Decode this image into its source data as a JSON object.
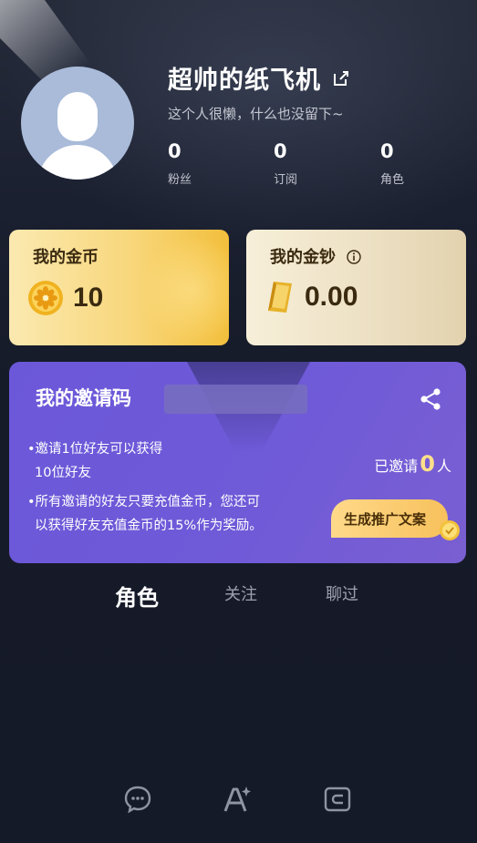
{
  "profile": {
    "name": "超帅的纸飞机",
    "bio": "这个人很懒，什么也没留下~",
    "stats": [
      {
        "value": "0",
        "label": "粉丝"
      },
      {
        "value": "0",
        "label": "订阅"
      },
      {
        "value": "0",
        "label": "角色"
      }
    ]
  },
  "wallet": {
    "coins": {
      "title": "我的金币",
      "value": "10",
      "icon": "coin-icon"
    },
    "cash": {
      "title": "我的金钞",
      "value": "0.00",
      "icon": "bill-icon"
    }
  },
  "invite": {
    "title": "我的邀请码",
    "bullets": [
      "•邀请1位好友可以获得",
      "10位好友",
      "•所有邀请的好友只要充值金币，您还可",
      "以获得好友充值金币的15%作为奖励。"
    ],
    "invited_prefix": "已邀请",
    "invited_count": "0",
    "invited_suffix": "人",
    "generate_label": "生成推广文案"
  },
  "tabs": [
    {
      "label": "角色",
      "active": true
    },
    {
      "label": "关注",
      "active": false
    },
    {
      "label": "聊过",
      "active": false
    }
  ],
  "bottom_nav": [
    "chat-icon",
    "ai-create-icon",
    "wallet-icon"
  ],
  "colors": {
    "background": "#161b29",
    "invite_purple": "#6b58d9",
    "gold_card": "#f8d77c",
    "highlight": "#ffe08a"
  }
}
